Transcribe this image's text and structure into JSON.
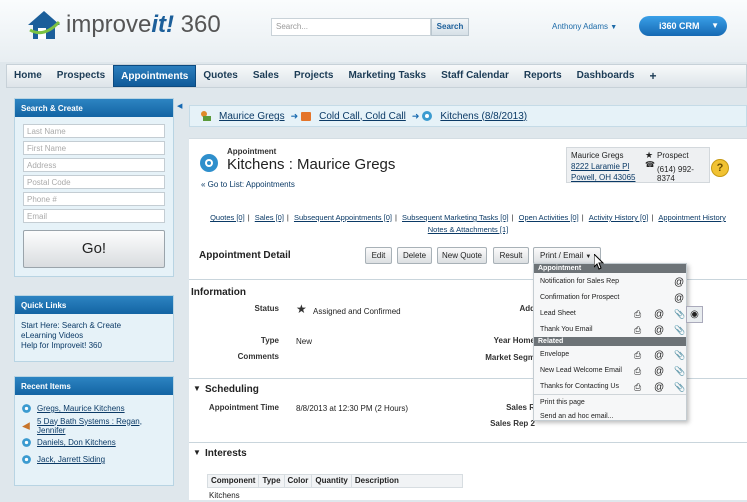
{
  "header": {
    "logo_text_pre": "improve",
    "logo_text_brand": "it!",
    "logo_text_post": " 360",
    "search_placeholder": "Search...",
    "search_button": "Search",
    "user": "Anthony Adams",
    "crm_button": "i360 CRM"
  },
  "nav": {
    "items": [
      "Home",
      "Prospects",
      "Appointments",
      "Quotes",
      "Sales",
      "Projects",
      "Marketing Tasks",
      "Staff Calendar",
      "Reports",
      "Dashboards",
      "+"
    ],
    "active_index": 2
  },
  "sidebar": {
    "search_create": {
      "title": "Search & Create",
      "fields": [
        "Last Name",
        "First Name",
        "Address",
        "Postal Code",
        "Phone #",
        "Email"
      ],
      "go_label": "Go!"
    },
    "quick_links": {
      "title": "Quick Links",
      "links": [
        "Start Here: Search & Create",
        "eLearning Videos",
        "Help for Improveit! 360"
      ]
    },
    "recent_items": {
      "title": "Recent Items",
      "items": [
        "Gregs, Maurice Kitchens",
        "5 Day Bath Systems : Regan, Jennifer",
        "Daniels, Don Kitchens",
        "Jack, Jarrett Siding"
      ]
    }
  },
  "breadcrumb": {
    "items": [
      "Maurice Gregs",
      "Cold Call, Cold Call",
      "Kitchens (8/8/2013)"
    ]
  },
  "record": {
    "type_label": "Appointment",
    "title": "Kitchens : Maurice Gregs",
    "go_to_list": "« Go to List: Appointments"
  },
  "contact_box": {
    "name": "Maurice Gregs",
    "address1": "8222 Laramie Pl",
    "address2": "Powell, OH 43065",
    "role": "Prospect",
    "phone": "(614) 992-8374"
  },
  "related_links": [
    "Quotes [0]",
    "Sales [0]",
    "Subsequent Appointments [0]",
    "Subsequent Marketing Tasks [0]",
    "Open Activities [0]",
    "Activity History [0]",
    "Appointment History",
    "Notes & Attachments [1]"
  ],
  "detail": {
    "title": "Appointment Detail",
    "buttons": {
      "edit": "Edit",
      "delete": "Delete",
      "new_quote": "New Quote",
      "result": "Result",
      "print_email": "Print / Email"
    }
  },
  "information": {
    "title": "Information",
    "status_label": "Status",
    "status_value": "Assigned and Confirmed",
    "type_label": "Type",
    "type_value": "New",
    "comments_label": "Comments",
    "address_label": "Add",
    "year_home_label": "Year Home",
    "market_seg_label": "Market Segm"
  },
  "scheduling": {
    "title": "Scheduling",
    "time_label": "Appointment Time",
    "time_value": "8/8/2013 at 12:30 PM (2 Hours)",
    "sales_rep_label": "Sales R",
    "sales_rep2_label": "Sales Rep 2"
  },
  "interests": {
    "title": "Interests",
    "columns": [
      "Component",
      "Type",
      "Color",
      "Quantity",
      "Description"
    ],
    "rows": [
      "Kitchens"
    ]
  },
  "dropdown": {
    "section1": "Appointment",
    "items1": [
      "Notification for Sales Rep",
      "Confirmation for Prospect",
      "Lead Sheet",
      "Thank You Email"
    ],
    "section2": "Related",
    "items2": [
      "Envelope",
      "New Lead Welcome Email",
      "Thanks for Contacting Us"
    ],
    "footer_items": [
      "Print this page",
      "Send an ad hoc email..."
    ]
  },
  "colors": {
    "accent": "#1669b3",
    "nav_active": "#0f5a99",
    "help": "#f1c232"
  }
}
